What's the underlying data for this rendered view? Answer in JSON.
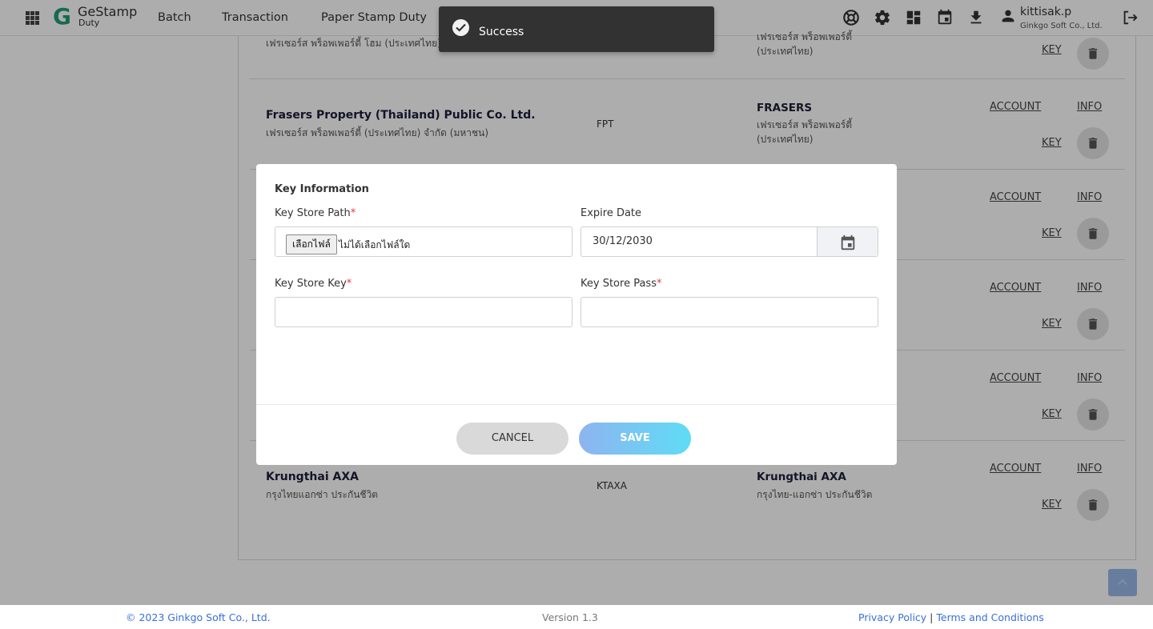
{
  "header": {
    "logo_text": "GeStamp",
    "logo_sub": "Duty",
    "nav": [
      "Batch",
      "Transaction",
      "Paper Stamp Duty"
    ],
    "user": {
      "name": "kittisak.p",
      "org": "Ginkgo Soft Co., Ltd."
    }
  },
  "companies": [
    {
      "name_th": "เฟรเซอร์ส พร็อพเพอร์ตี้ โฮม (ประเทศไทย)",
      "short_th": "เฟรเซอร์ส พร็อพเพอร์ตี้ (ประเทศไทย)",
      "key_label": "KEY"
    },
    {
      "name_en": "Frasers Property (Thailand) Public Co. Ltd.",
      "name_th": "เฟรเซอร์ส พร็อพเพอร์ตี้ (ประเทศไทย) จำกัด (มหาชน)",
      "code": "FPT",
      "short_en": "FRASERS",
      "short_th": "เฟรเซอร์ส พร็อพเพอร์ตี้ (ประเทศไทย)",
      "account_label": "ACCOUNT",
      "info_label": "INFO",
      "key_label": "KEY"
    },
    {
      "account_label": "ACCOUNT",
      "info_label": "INFO",
      "key_label": "KEY"
    },
    {
      "account_label": "ACCOUNT",
      "info_label": "INFO",
      "key_label": "KEY"
    },
    {
      "account_label": "ACCOUNT",
      "info_label": "INFO",
      "key_label": "KEY"
    },
    {
      "name_en": "Krungthai AXA",
      "name_th": "กรุงไทยแอกซ่า ประกันชีวิต",
      "code": "KTAXA",
      "short_en": "Krungthai AXA",
      "short_th": "กรุงไทย-แอกซ่า ประกันชีวิต",
      "account_label": "ACCOUNT",
      "info_label": "INFO",
      "key_label": "KEY"
    }
  ],
  "modal": {
    "title": "Key Information",
    "key_store_path_label": "Key Store Path",
    "required_mark": "*",
    "file_button": "เลือกไฟล์",
    "file_status": "ไม่ได้เลือกไฟล์ใด",
    "expire_date_label": "Expire Date",
    "expire_date_value": "30/12/2030",
    "key_store_key_label": "Key Store Key",
    "key_store_key_value": "",
    "key_store_pass_label": "Key Store Pass",
    "key_store_pass_value": "",
    "cancel_label": "CANCEL",
    "save_label": "SAVE"
  },
  "toast": {
    "message": "Success"
  },
  "footer": {
    "copyright": "© 2023 Ginkgo Soft Co., Ltd.",
    "version": "Version 1.3",
    "privacy": "Privacy Policy",
    "separator": "|",
    "terms": "Terms and Conditions"
  },
  "colors": {
    "accent_link": "#3a6fd8",
    "save_gradient_start": "#8eb4f0",
    "save_gradient_end": "#5fdcf5",
    "toast_bg": "#323232",
    "logo_green": "#1f9d7a"
  },
  "icons": {
    "top_bar": [
      "apps-grid-icon",
      "support-lifebuoy-icon",
      "settings-gear-icon",
      "dashboard-icon",
      "calendar-icon",
      "download-icon",
      "user-icon",
      "logout-icon"
    ],
    "row_actions": [
      "trash-icon"
    ],
    "modal": [
      "calendar-icon"
    ],
    "toast": [
      "check-circle-icon"
    ]
  }
}
